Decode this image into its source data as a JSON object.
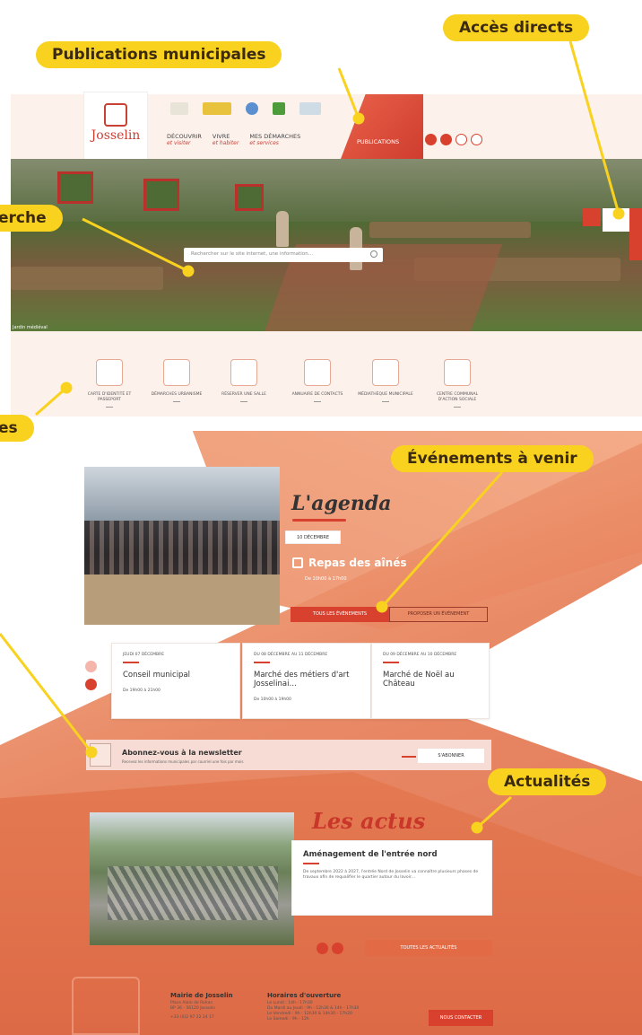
{
  "callouts": {
    "publications": "Publications municipales",
    "acces_directs": "Accès directs",
    "recherche": "erche",
    "raccourcis": "es",
    "evenements": "Événements à venir",
    "actualites": "Actualités"
  },
  "site": {
    "logo": "Josselin",
    "nav": [
      {
        "label": "DÉCOUVRIR",
        "sub": "et visiter"
      },
      {
        "label": "VIVRE",
        "sub": "et habiter"
      },
      {
        "label": "MES DÉMARCHES",
        "sub": "et services"
      }
    ],
    "publications": "PUBLICATIONS"
  },
  "hero": {
    "search_placeholder": "Rechercher sur le site internet, une information…",
    "caption": "Jardin médiéval"
  },
  "quick_access": [
    "CARTE D'IDENTITÉ ET PASSEPORT",
    "DÉMARCHES URBANISME",
    "RÉSERVER UNE SALLE",
    "ANNUAIRE DE CONTACTS",
    "MÉDIATHÈQUE MUNICIPALE",
    "CENTRE COMMUNAL D'ACTION SOCIALE"
  ],
  "agenda": {
    "title": "L'agenda",
    "featured_date": "10 DÉCEMBRE",
    "featured_name": "Repas des aînés",
    "featured_time": "De 10h00 à 17h00",
    "all_events": "TOUS LES ÉVÉNEMENTS",
    "propose": "PROPOSER UN ÉVÉNEMENT",
    "events": [
      {
        "date": "JEUDI 07 DÉCEMBRE",
        "title": "Conseil municipal",
        "time": "De 19h00 à 21h00"
      },
      {
        "date": "DU 08 DÉCEMBRE AU 11 DÉCEMBRE",
        "title": "Marché des métiers d'art Josselinai…",
        "time": "De 10h00 à 19h00"
      },
      {
        "date": "DU 09 DÉCEMBRE AU 10 DÉCEMBRE",
        "title": "Marché de Noël au Château",
        "time": ""
      }
    ]
  },
  "newsletter": {
    "title": "Abonnez-vous à la newsletter",
    "subtitle": "Recevez les informations municipales par courriel une fois par mois",
    "button": "S'ABONNER"
  },
  "actus": {
    "title": "Les actus",
    "card_title": "Aménagement de l'entrée nord",
    "card_text": "De septembre 2022 à 2027, l'entrée Nord de Josselin va connaître plusieurs phases de travaux afin de requalifier le quartier autour du lavoir…",
    "all": "TOUTES LES ACTUALITÉS"
  },
  "footer": {
    "mairie_title": "Mairie de Josselin",
    "mairie_lines": [
      "Place Alain de Rohan",
      "BP 36 - 56120 Josselin",
      "+33 (0)2 97 22 24 17"
    ],
    "hours_title": "Horaires d'ouverture",
    "hours_lines": [
      "Le Lundi : 14h - 17h30",
      "Du Mardi au Jeudi : 9h - 12h30 & 14h - 17h30",
      "Le Vendredi : 9h - 12h30 & 14h30 - 17h20",
      "Le Samedi : 9h - 12h"
    ],
    "contact": "NOUS CONTACTER"
  }
}
